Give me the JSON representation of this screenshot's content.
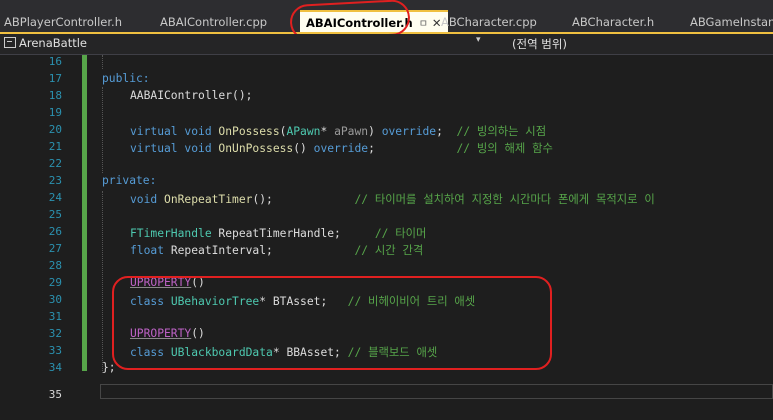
{
  "tabs": [
    {
      "label": "ABPlayerController.h"
    },
    {
      "label": "ABAIController.cpp"
    },
    {
      "label": "ABAIController.h",
      "pin": "ㅁ",
      "close": "✕"
    },
    {
      "label": "ABCharacter.cpp"
    },
    {
      "label": "ABCharacter.h"
    },
    {
      "label": "ABGameInstanc"
    }
  ],
  "navbar": {
    "project": "ArenaBattle",
    "dropdown": "▾",
    "scope": "(전역 범위)"
  },
  "line_numbers": [
    "16",
    "17",
    "18",
    "19",
    "20",
    "21",
    "22",
    "23",
    "24",
    "25",
    "26",
    "27",
    "28",
    "29",
    "30",
    "31",
    "32",
    "33",
    "34",
    "35"
  ],
  "code": {
    "l17": "public:",
    "l18": "AABAIController();",
    "l20": {
      "kw": "virtual void ",
      "fn": "OnPossess",
      "op": "(",
      "ty": "APawn",
      "mid": "* ",
      "pa": "aPawn",
      "end": ") ",
      "kw2": "override",
      "semi": ";  ",
      "cm": "// 빙의하는 시점"
    },
    "l21": {
      "kw": "virtual void ",
      "fn": "OnUnPossess",
      "mid": "() ",
      "kw2": "override",
      "semi": ";            ",
      "cm": "// 빙의 해제 함수"
    },
    "l23": "private:",
    "l24": {
      "kw": "void ",
      "fn": "OnRepeatTimer",
      "mid": "();            ",
      "cm": "// 타이머를 설치하여 지정한 시간마다 폰에게 목적지로 이"
    },
    "l26": {
      "ty": "FTimerHandle",
      "mid": " RepeatTimerHandle;     ",
      "cm": "// 타이머"
    },
    "l27": {
      "kw": "float",
      "mid": " RepeatInterval;            ",
      "cm": "// 시간 간격"
    },
    "l29": {
      "mac": "UPROPERTY",
      "end": "()"
    },
    "l30": {
      "kw": "class ",
      "ty": "UBehaviorTree",
      "mid": "* BTAsset;   ",
      "cm": "// 비헤이비어 트리 애셋"
    },
    "l32": {
      "mac": "UPROPERTY",
      "end": "()"
    },
    "l33": {
      "kw": "class ",
      "ty": "UBlackboardData",
      "mid": "* BBAsset; ",
      "cm": "// 블랙보드 애셋"
    },
    "l34": "};"
  },
  "colors": {
    "keyword": "#569cd6",
    "type": "#4ec9b0",
    "function": "#dcdcaa",
    "comment": "#57a64a",
    "macro": "#bd63c5",
    "line_number": "#2b91af",
    "annotation": "#e02020"
  }
}
